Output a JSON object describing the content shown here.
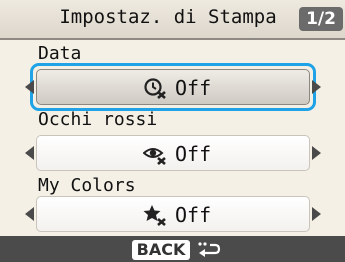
{
  "header": {
    "title": "Impostaz. di Stampa",
    "page_indicator": "1/2"
  },
  "settings": [
    {
      "label": "Data",
      "value": "Off",
      "icon": "date-imprint-icon",
      "selected": true
    },
    {
      "label": "Occhi rossi",
      "value": "Off",
      "icon": "red-eye-correction-icon",
      "selected": false
    },
    {
      "label": "My Colors",
      "value": "Off",
      "icon": "my-colors-icon",
      "selected": false
    }
  ],
  "footer": {
    "back_label": "BACK",
    "back_icon": "return-arrow-icon"
  },
  "colors": {
    "focus_ring": "#1fa3e6",
    "page_badge": "#6b6b6b",
    "bottom_bar": "#4b4b4b"
  }
}
